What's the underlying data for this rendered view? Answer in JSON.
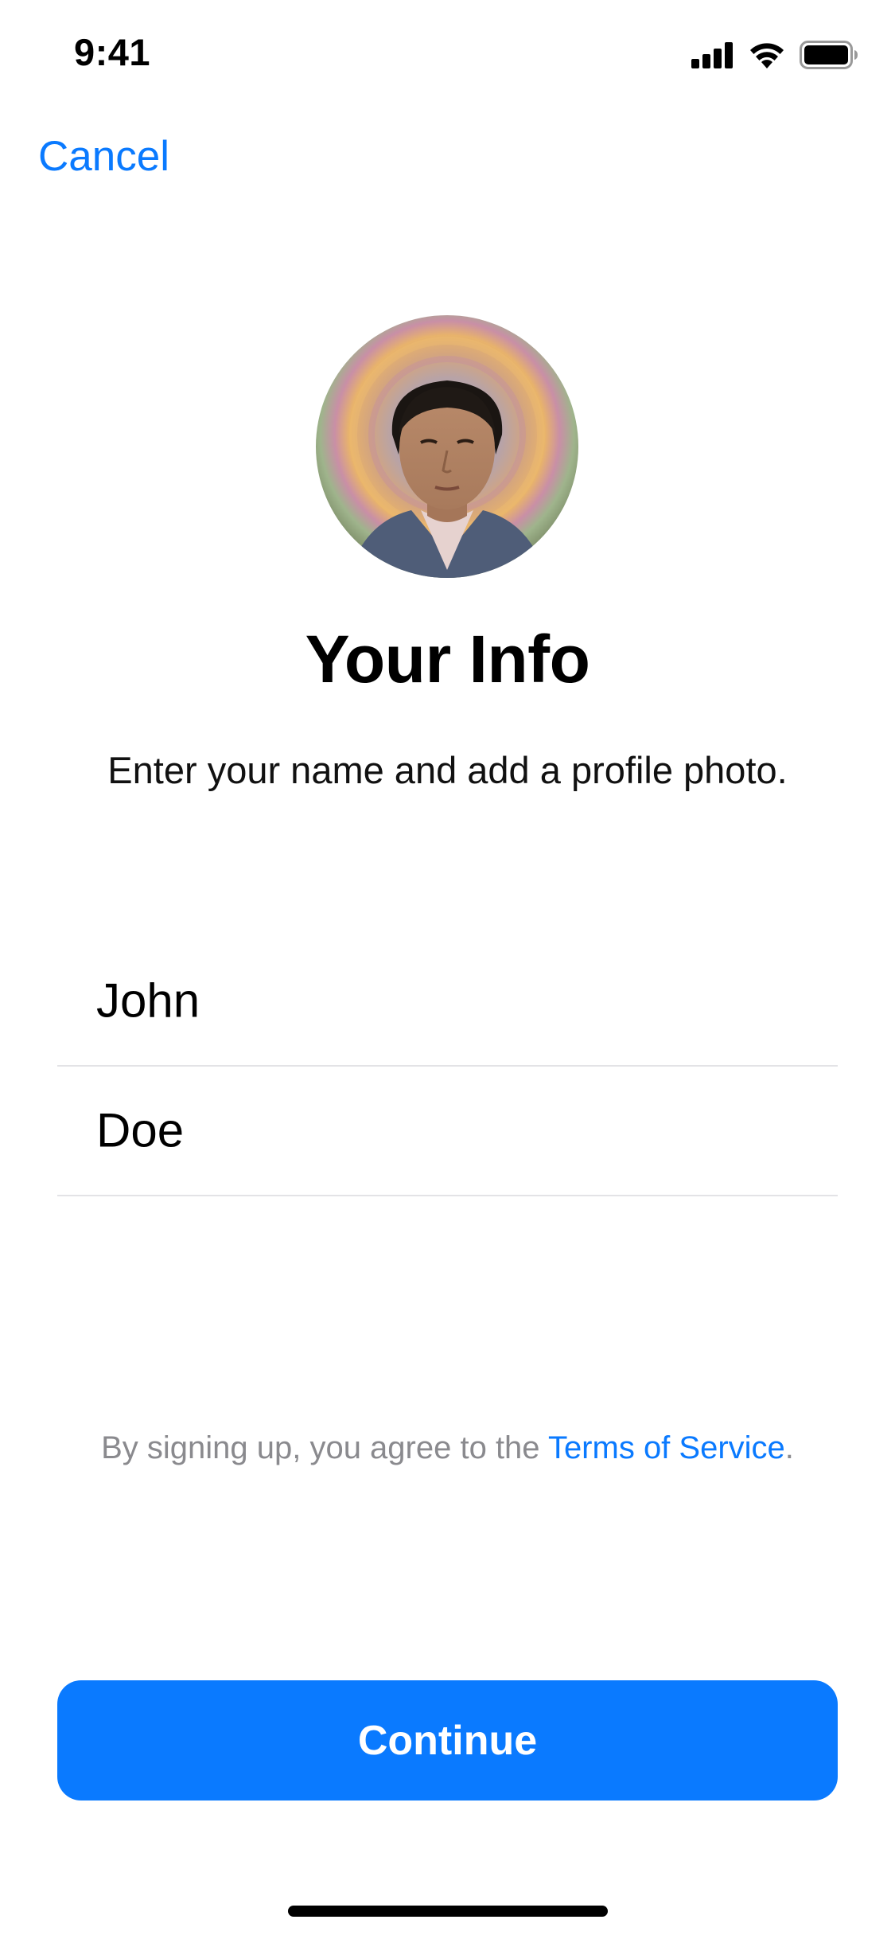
{
  "status_bar": {
    "time": "9:41",
    "icons": [
      "signal-icon",
      "wifi-icon",
      "battery-icon"
    ]
  },
  "nav": {
    "cancel_label": "Cancel"
  },
  "profile": {
    "avatar": "profile-photo"
  },
  "header": {
    "title": "Your Info",
    "subtitle": "Enter your name and add a profile photo."
  },
  "form": {
    "first_name": {
      "value": "John"
    },
    "last_name": {
      "value": "Doe"
    }
  },
  "terms": {
    "prefix": "By signing up, you agree to the ",
    "link_label": "Terms of Service",
    "suffix": "."
  },
  "actions": {
    "continue_label": "Continue"
  },
  "colors": {
    "accent": "#0a7aff",
    "text": "#000000",
    "secondary_text": "#8a8a8e",
    "separator": "#e3e3e6",
    "background": "#ffffff"
  }
}
